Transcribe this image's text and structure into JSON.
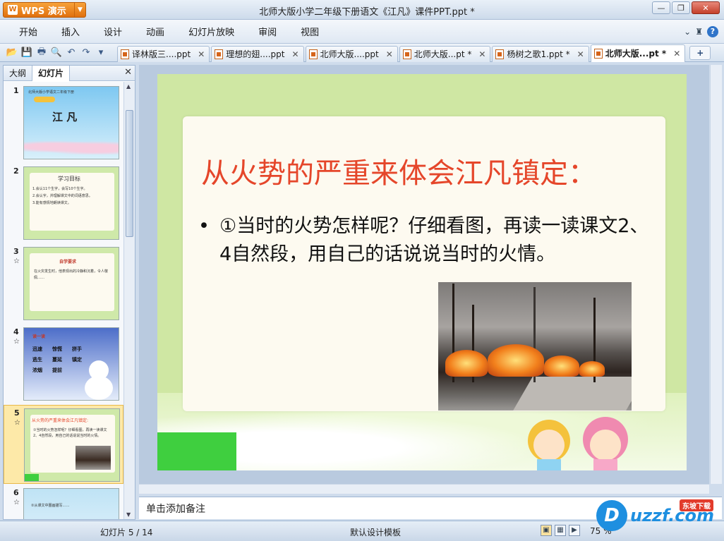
{
  "titlebar": {
    "app_button": "WPS 演示",
    "title": "北师大版小学二年级下册语文《江凡》课件PPT.ppt *",
    "minimize": "—",
    "restore": "❐",
    "close": "✕"
  },
  "menu": {
    "items": [
      "开始",
      "插入",
      "设计",
      "动画",
      "幻灯片放映",
      "审阅",
      "视图"
    ],
    "right_chevron": "⌄",
    "shirt": "👕",
    "help": "?"
  },
  "toolbar": {
    "icons": [
      "open-icon",
      "save-icon",
      "print-icon",
      "print-preview-icon",
      "undo-icon",
      "redo-icon",
      "customize-icon"
    ],
    "tabs": [
      {
        "label": "译林版三....ppt",
        "active": false
      },
      {
        "label": "理想的翅....ppt",
        "active": false
      },
      {
        "label": "北师大版....ppt",
        "active": false
      },
      {
        "label": "北师大版...pt *",
        "active": false
      },
      {
        "label": "杨树之歌1.ppt *",
        "active": false
      },
      {
        "label": "北师大版...pt *",
        "active": true
      }
    ],
    "new_tab": "+"
  },
  "left_panel": {
    "tabs": [
      "大纲",
      "幻灯片"
    ],
    "close": "✕",
    "thumbnails": [
      {
        "num": "1",
        "star": "",
        "title": "江  凡",
        "subtitle": "北师大版小学语文二年级下册"
      },
      {
        "num": "2",
        "star": "",
        "title": "学习目标",
        "text": "1.会认11个生字，会写10个生字。\n2.会认字，并理解课文中的词语意思。\n3.能有感情地朗读课文。"
      },
      {
        "num": "3",
        "star": "☆",
        "title": "自学要求",
        "text": "在火灾发生时，他表现出的冷静和沉着，令人敬佩……"
      },
      {
        "num": "4",
        "star": "☆",
        "title": "读一读",
        "words": [
          "迅速",
          "惊慌",
          "拼手",
          "逃生",
          "蔓延",
          "镇定",
          "浓烟",
          "提前"
        ]
      },
      {
        "num": "5",
        "star": "☆",
        "title": "从火势的严重来体会江凡镇定:",
        "text": "①当时的火势怎样呢？仔细看图，再读一读课文2、4自然段，用自己的话说说当时的火情。"
      },
      {
        "num": "6",
        "star": "☆",
        "title": "",
        "text": "②从课文中圈画描写……"
      }
    ]
  },
  "slide": {
    "title": "从火势的严重来体会江凡镇定：",
    "bullet_marker": "•",
    "bullet_text": "①当时的火势怎样呢？仔细看图，再读一读课文2、4自然段，用自己的话说说当时的火情。",
    "photo_alt": "fire-photo"
  },
  "notes": {
    "placeholder": "单击添加备注"
  },
  "statusbar": {
    "slide_counter": "幻灯片 5 / 14",
    "template": "默认设计模板",
    "zoom": "75 %"
  },
  "watermark": {
    "brand": "uzzf.com",
    "badge": "东坡下载"
  }
}
